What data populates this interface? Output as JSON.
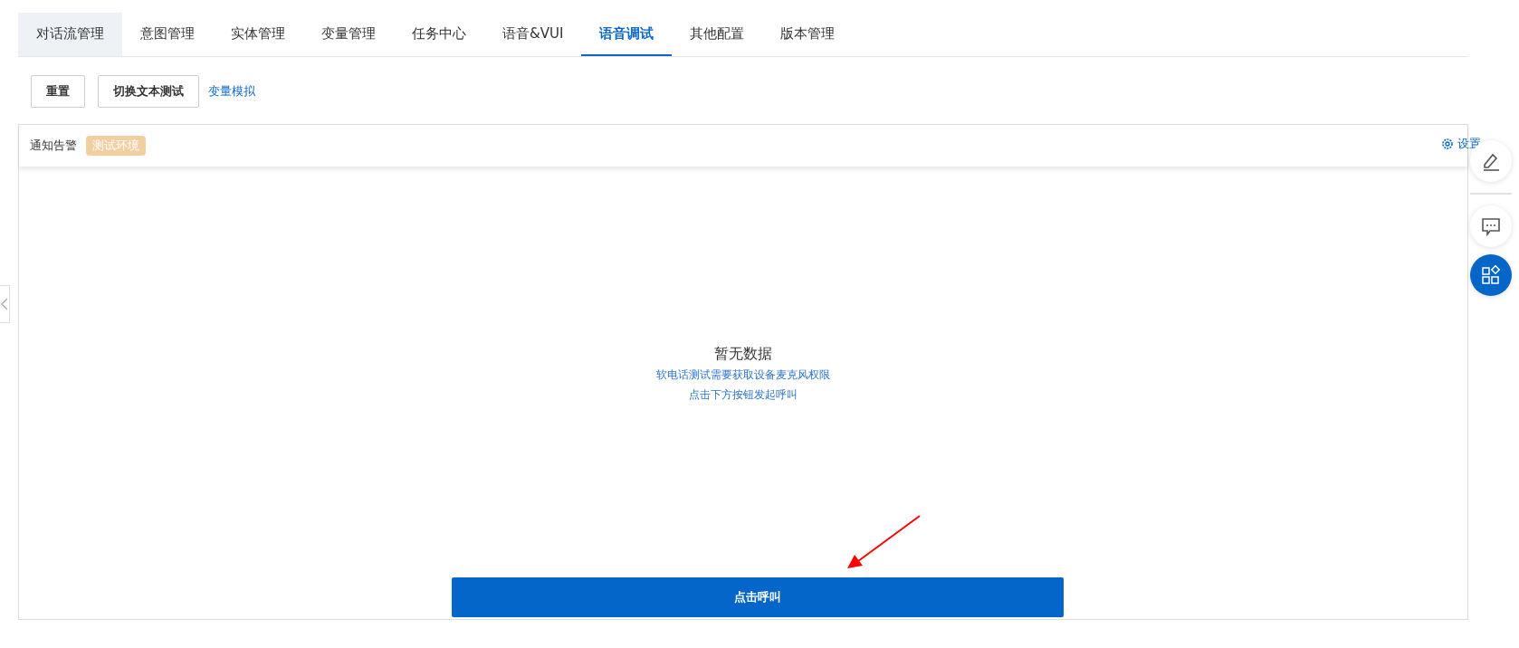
{
  "tabs": [
    {
      "label": "对话流管理",
      "selected": false,
      "hovered": true
    },
    {
      "label": "意图管理",
      "selected": false,
      "hovered": false
    },
    {
      "label": "实体管理",
      "selected": false,
      "hovered": false
    },
    {
      "label": "变量管理",
      "selected": false,
      "hovered": false
    },
    {
      "label": "任务中心",
      "selected": false,
      "hovered": false
    },
    {
      "label": "语音&VUI",
      "selected": false,
      "hovered": false
    },
    {
      "label": "语音调试",
      "selected": true,
      "hovered": false
    },
    {
      "label": "其他配置",
      "selected": false,
      "hovered": false
    },
    {
      "label": "版本管理",
      "selected": false,
      "hovered": false
    }
  ],
  "toolbar": {
    "buttons": [
      "重置",
      "切换文本测试"
    ],
    "link": "变量模拟"
  },
  "panel": {
    "title": "通知告警",
    "tag": "测试环境",
    "settings": "设置",
    "empty": {
      "title": "暂无数据",
      "lines": [
        "软电话测试需要获取设备麦克风权限",
        "点击下方按钮发起呼叫"
      ]
    },
    "call_button": "点击呼叫"
  }
}
